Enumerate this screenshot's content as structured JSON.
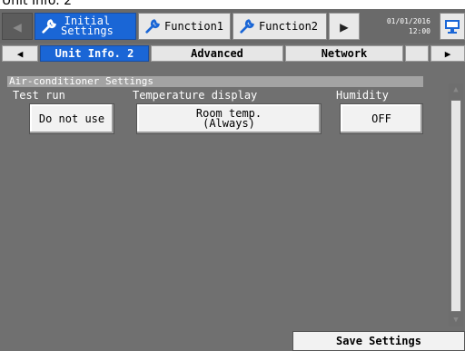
{
  "page_caption": "Unit Info. 2",
  "function_tabs": [
    {
      "label_line1": "Initial",
      "label_line2": "Settings",
      "active": true
    },
    {
      "label": "Function1",
      "active": false
    },
    {
      "label": "Function2",
      "active": false
    }
  ],
  "clock": {
    "date": "01/01/2016",
    "time": "12:00"
  },
  "sub_tabs": [
    "Unit Info. 2",
    "Advanced",
    "Network",
    ""
  ],
  "section": {
    "title": "Air-conditioner Settings"
  },
  "settings": {
    "test_run": {
      "label": "Test run",
      "value": "Do not use"
    },
    "temperature_display": {
      "label": "Temperature display",
      "value_line1": "Room temp.",
      "value_line2": "(Always)"
    },
    "humidity": {
      "label": "Humidity",
      "value": "OFF"
    }
  },
  "footer": {
    "save_label": "Save Settings"
  },
  "colors": {
    "active_tab": "#1a66d6",
    "panel": "#707070",
    "section_head": "#a3a3a3"
  },
  "icons": [
    "wrench-icon",
    "monitor-icon",
    "left-arrow-icon",
    "right-arrow-icon",
    "scroll-up-icon",
    "scroll-down-icon"
  ]
}
